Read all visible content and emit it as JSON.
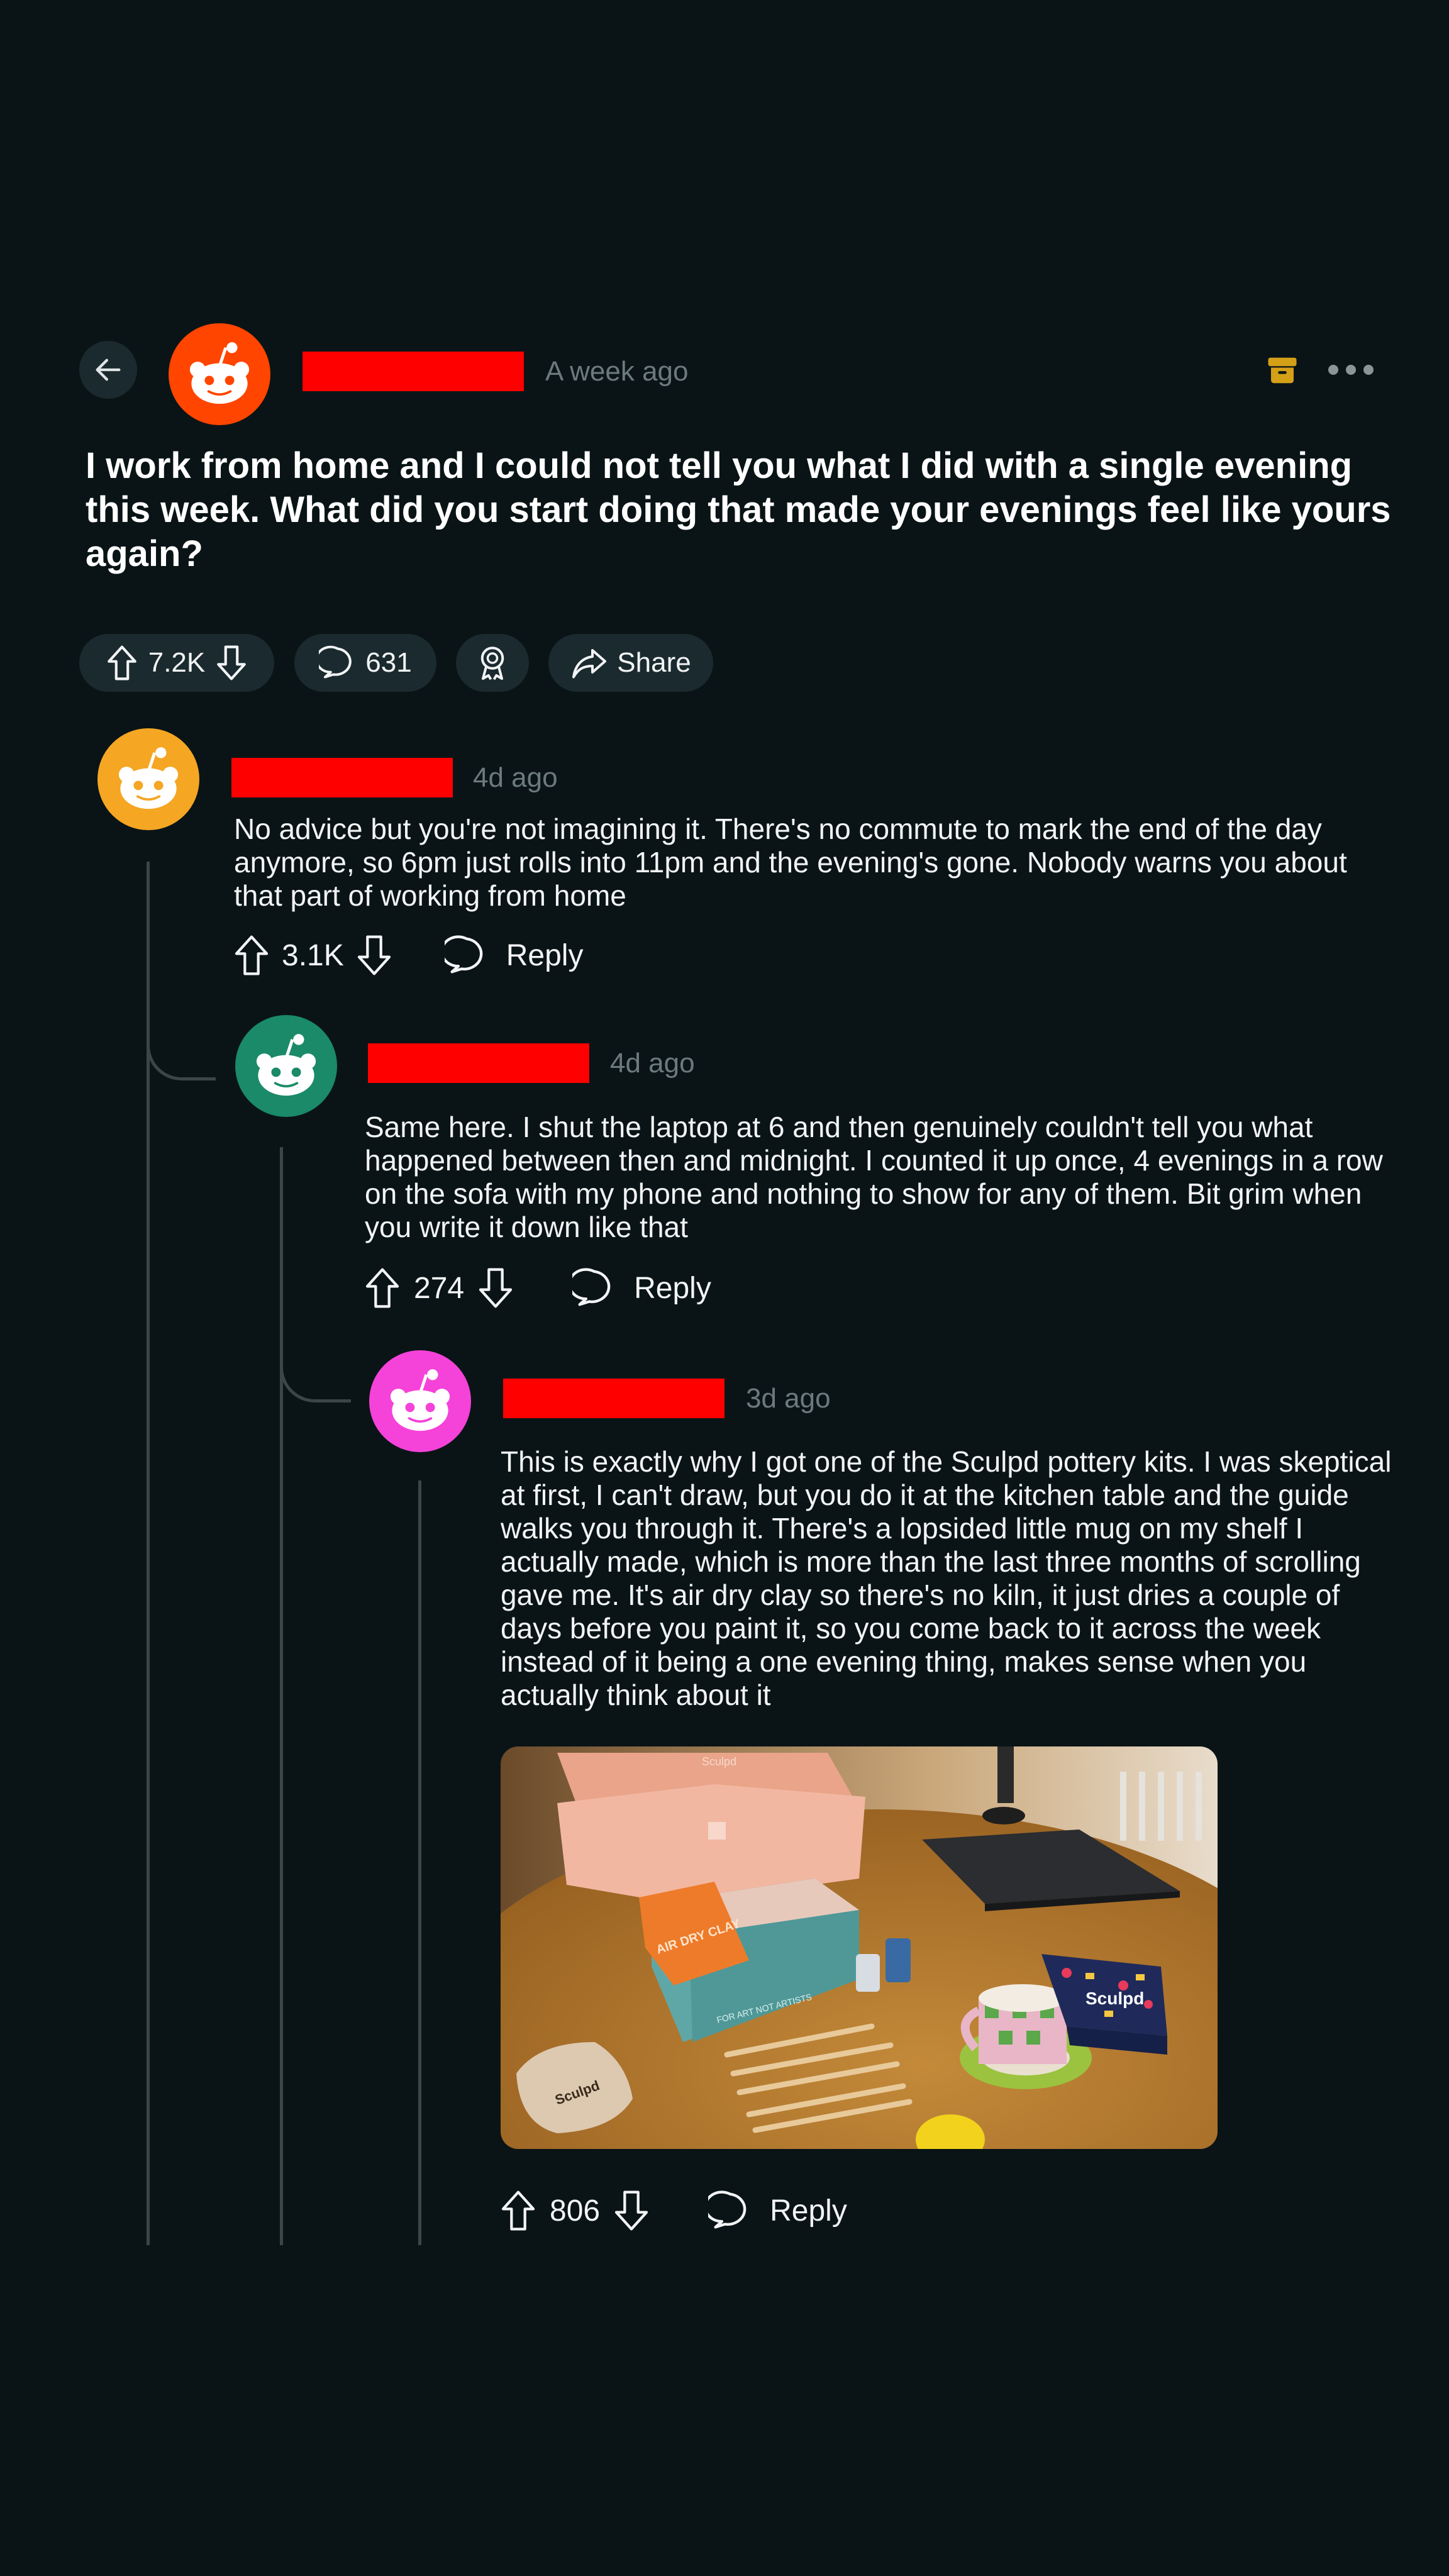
{
  "post": {
    "time": "A week ago",
    "title": "I work from home and I could not tell you what I did with a single evening this week. What did you start doing that made your evenings feel like yours again?",
    "upvotes": "7.2K",
    "comments": "631",
    "share_label": "Share"
  },
  "comments": [
    {
      "time": "4d ago",
      "text": "No advice but you're not imagining it. There's no commute to mark the end of the day anymore, so 6pm just rolls into 11pm and the evening's gone. Nobody warns you about that part of working from home",
      "votes": "3.1K",
      "reply_label": "Reply",
      "avatar_color": "#f5a623"
    },
    {
      "time": "4d ago",
      "text": "Same here. I shut the laptop at 6 and then genuinely couldn't tell you what happened between then and midnight. I counted it up once, 4 evenings in a row on the sofa with my phone and nothing to show for any of them. Bit grim when you write it down like that",
      "votes": "274",
      "reply_label": "Reply",
      "avatar_color": "#1a8a68"
    },
    {
      "time": "3d ago",
      "text": "This is exactly why I got one of the Sculpd pottery kits. I was skeptical at first, I can't draw, but you do it at the kitchen table and the guide walks you through it. There's a lopsided little mug on my shelf I actually made, which is more than the last three months of scrolling gave me. It's air dry clay so there's no kiln, it just dries a couple of days before you paint it, so you come back to it across the week instead of it being a one evening thing, makes sense when you actually think about it",
      "votes": "806",
      "reply_label": "Reply",
      "avatar_color": "#f542d9"
    }
  ],
  "photo": {
    "box_brand": "Sculpd",
    "bag_label": "AIR DRY CLAY",
    "box_text": "FOR ART NOT ARTISTS",
    "pouch_label": "Sculpd",
    "game_label": "Sculpd"
  },
  "colors": {
    "background": "#0a1416",
    "accent": "#ff4500",
    "redaction": "#ff0000",
    "archive": "#d4a017"
  }
}
